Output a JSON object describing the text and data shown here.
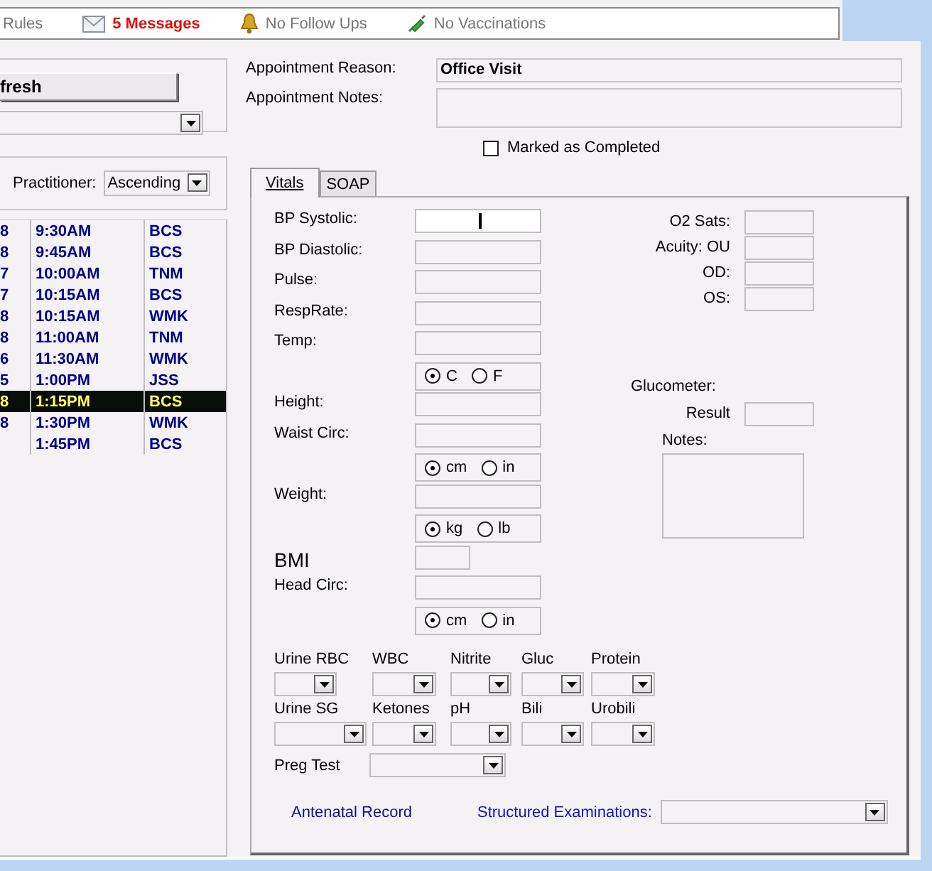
{
  "status_bar": [
    {
      "kind": "rules",
      "label": "Rules"
    },
    {
      "kind": "messages",
      "label": "5 Messages"
    },
    {
      "kind": "followups",
      "label": "No Follow Ups"
    },
    {
      "kind": "vaccinations",
      "label": "No Vaccinations"
    }
  ],
  "refresh_button": "fresh",
  "sort": {
    "label": "Practitioner:",
    "value": "Ascending"
  },
  "appointments": [
    {
      "column_1": "8",
      "time": "9:30AM",
      "practitioner": "BCS",
      "selected": false
    },
    {
      "column_1": "8",
      "time": "9:45AM",
      "practitioner": "BCS",
      "selected": false
    },
    {
      "column_1": "7",
      "time": "10:00AM",
      "practitioner": "TNM",
      "selected": false
    },
    {
      "column_1": "7",
      "time": "10:15AM",
      "practitioner": "BCS",
      "selected": false
    },
    {
      "column_1": "8",
      "time": "10:15AM",
      "practitioner": "WMK",
      "selected": false
    },
    {
      "column_1": "8",
      "time": "11:00AM",
      "practitioner": "TNM",
      "selected": false
    },
    {
      "column_1": "6",
      "time": "11:30AM",
      "practitioner": "WMK",
      "selected": false
    },
    {
      "column_1": "5",
      "time": "1:00PM",
      "practitioner": "JSS",
      "selected": false
    },
    {
      "column_1": "8",
      "time": "1:15PM",
      "practitioner": "BCS",
      "selected": true
    },
    {
      "column_1": "8",
      "time": "1:30PM",
      "practitioner": "WMK",
      "selected": false
    },
    {
      "time": "1:45PM",
      "practitioner": "BCS",
      "selected": false
    }
  ],
  "appointment": {
    "reason_label": "Appointment Reason:",
    "reason": "Office Visit",
    "notes_label": "Appointment Notes:",
    "completed_label": "Marked as Completed",
    "completed": false
  },
  "tabs": [
    {
      "label": "Vitals",
      "selected": true
    },
    {
      "label": "SOAP",
      "selected": false
    }
  ],
  "vitals": [
    {
      "kind": "field",
      "label": "BP Systolic:",
      "focused": true
    },
    {
      "kind": "field",
      "label": "BP Diastolic:",
      "focused": false
    },
    {
      "kind": "field",
      "label": "Pulse:",
      "focused": false
    },
    {
      "kind": "field",
      "label": "RespRate:",
      "focused": false
    },
    {
      "kind": "field",
      "label": "Temp:",
      "focused": false
    },
    {
      "kind": "units",
      "options": [
        {
          "label": "C",
          "selected": true
        },
        {
          "label": "F",
          "selected": false
        }
      ]
    },
    {
      "kind": "field",
      "label": "Height:",
      "focused": false
    },
    {
      "kind": "field",
      "label": "Waist Circ:",
      "focused": false
    },
    {
      "kind": "units",
      "options": [
        {
          "label": "cm",
          "selected": true
        },
        {
          "label": "in",
          "selected": false
        }
      ]
    },
    {
      "kind": "field",
      "label": "Weight:",
      "focused": false
    },
    {
      "kind": "units",
      "options": [
        {
          "label": "kg",
          "selected": true
        },
        {
          "label": "lb",
          "selected": false
        }
      ]
    },
    {
      "kind": "short",
      "label": "BMI",
      "focused": false
    },
    {
      "kind": "field",
      "label": "Head Circ:",
      "focused": false
    },
    {
      "kind": "units",
      "options": [
        {
          "label": "cm",
          "selected": true
        },
        {
          "label": "in",
          "selected": false
        }
      ]
    }
  ],
  "eye_fields": [
    {
      "label": "O2 Sats:"
    },
    {
      "label": "Acuity: OU"
    },
    {
      "label": "OD:"
    },
    {
      "label": "OS:"
    }
  ],
  "glucometer": {
    "label": "Glucometer:",
    "result_label": "Result",
    "notes_label": "Notes:"
  },
  "urinalysis": [
    {
      "items": [
        {
          "label": "Urine RBC"
        },
        {
          "label": "WBC"
        },
        {
          "label": "Nitrite"
        },
        {
          "label": "Gluc"
        },
        {
          "label": "Protein"
        }
      ]
    },
    {
      "items": [
        {
          "label": "Urine SG"
        },
        {
          "label": "Ketones"
        },
        {
          "label": "pH"
        },
        {
          "label": "Bili"
        },
        {
          "label": "Urobili"
        }
      ]
    }
  ],
  "preg_test": {
    "label": "Preg Test"
  },
  "antenatal_link": "Antenatal Record",
  "structured_examinations_label": "Structured Examinations:"
}
